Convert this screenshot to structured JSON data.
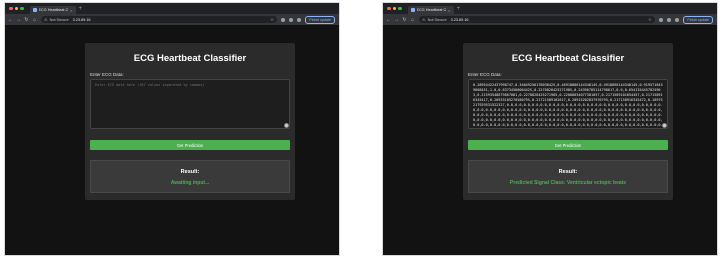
{
  "colors": {
    "close": "#ff5f57",
    "minimize": "#febc2e",
    "maximize": "#28c840",
    "accent": "#4caf50",
    "link": "#8ab4f8"
  },
  "left": {
    "tab_title": "ECG Heartbeat Classification",
    "address": {
      "security_label": "Not Secure",
      "url": "3.23.69.16"
    },
    "update_button": "Finish update",
    "app": {
      "title": "ECG Heartbeat Classifier",
      "input_label": "Enter ECG Data:",
      "input_placeholder": "Enter ECG data here (187 values separated by commas)",
      "input_value": "",
      "predict_button": "Get Prediction",
      "result_title": "Result:",
      "result_value": "Awaiting input..."
    }
  },
  "right": {
    "tab_title": "ECG Heartbeat Classification",
    "address": {
      "security_label": "Not Secure",
      "url": "3.23.69.16"
    },
    "update_button": "Finish update",
    "app": {
      "title": "ECG Heartbeat Classifier",
      "input_label": "Enter ECG Data:",
      "input_placeholder": "",
      "input_value": "0.28954422437998747,0.34049256178038425,0.4691888614434814S,0.4918898144348145,0.9195718439608451,1.0,0.6373456006442S,0.2270828425271985,0.24396785114798617,0.0,0.6541354457825963,0.21593548879867081,0.2270828425271985,0.22008834077381057,0.2171589101654457,0.217158916345417,0.2093318527058079S,0.21721589102617,0.20915202837970795,0.217158916345472,0.18975217929531522327,0.0,0.0,0.0,0.0,0.0,0.0,0.0,0.0,0.0,0.0,0.0,0.0,0.0,0.0,0.0,0.0,0.0,0.0,0.0,0.0,0.0,0.0,0.0,0.0,0.0,0.0,0.0,0.0,0.0,0.0,0.0,0.0,0.0,0.0,0.0,0.0,0.0,0.0,0.0,0.0,0.0,0.0,0.0,0.0,0.0,0.0,0.0,0.0,0.0,0.0,0.0,0.0,0.0,0.0,0.0,0.0,0.0,0.0,0.0,0.0,0.0,0.0,0.0,0.0,0.0,0.0,0.0,0.0,0.0,0.0,0.0,0.0,0.0,0.0,0.0,0.0,0.0,0.0,0.0,0.0,0.0,0.0,0.0,0.0,0.0,0.0,0.0,0.0,0.0,0.0,0.0,0.0,0.0,0.0,0.0,0.0,0.0,0.0,0.0,0.0,0.0,0.0,0.0,0.0,0.0,0.0,0.0,0.0,0.0,0.0,0.0,0.0,0.0,0.0,0.0,0.0,0.0,0.0,0.0",
      "predict_button": "Get Prediction",
      "result_title": "Result:",
      "result_value": "Predicted Signal Class: Ventricular ectopic beats"
    }
  }
}
